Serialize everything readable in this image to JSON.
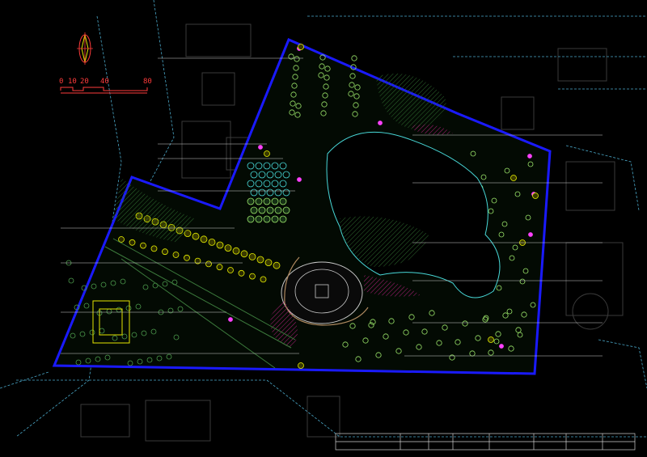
{
  "drawing": {
    "type": "landscape master plan (CAD)",
    "background": "#000000",
    "boundary_color": "#1a1aff",
    "road_color": "#4aa8c9",
    "building_color": "#3a3a3a"
  },
  "north_arrow": {
    "icon": "north-arrow-icon",
    "color": "#ff3b3b"
  },
  "scale_bar": {
    "labels": [
      "0",
      "10",
      "20",
      "40",
      "80"
    ],
    "color": "#ff3b3b"
  },
  "title_block": {
    "cells": [
      "",
      "",
      "",
      "",
      "",
      "",
      "",
      "",
      "",
      "",
      "",
      ""
    ]
  },
  "plant_colors": {
    "yellow_trees": "#e6f000",
    "light_green": "#9be56a",
    "cyan_shrubs": "#48d8d8",
    "magenta_flowers": "#ff40ff",
    "pink_hatch": "#e0208f",
    "white_shrubs": "#d8d8d8"
  }
}
